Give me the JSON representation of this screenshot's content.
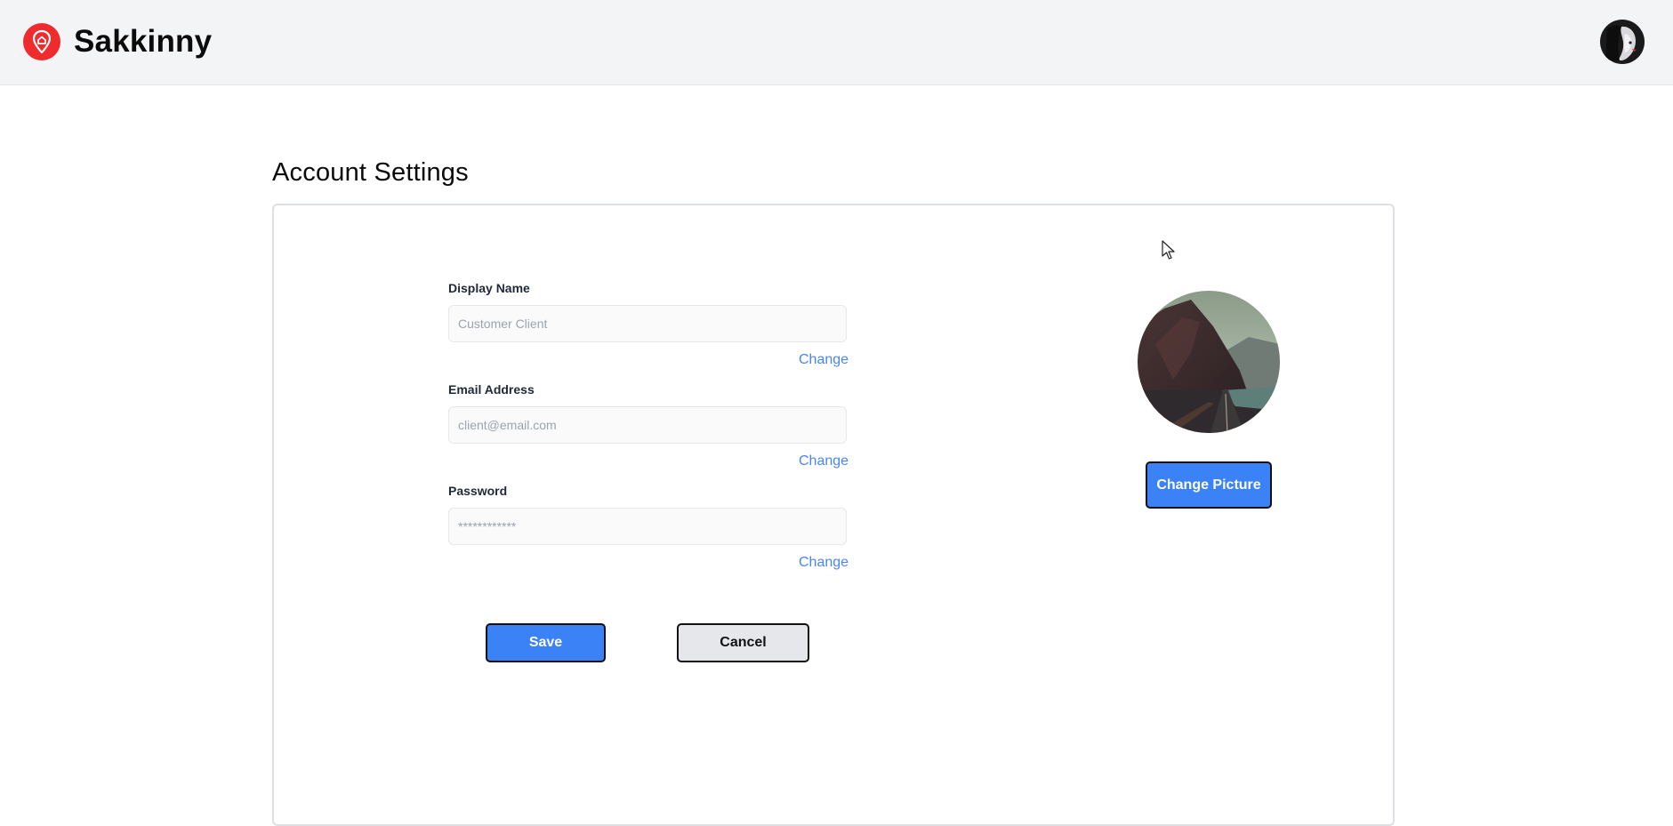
{
  "header": {
    "brand_name": "Sakkinny",
    "logo_icon": "location-pin-icon",
    "avatar_icon": "user-avatar",
    "brand_color": "#ef2b2d"
  },
  "page": {
    "title": "Account Settings"
  },
  "form": {
    "display_name": {
      "label": "Display Name",
      "placeholder": "Customer Client",
      "value": "",
      "change_label": "Change"
    },
    "email": {
      "label": "Email Address",
      "placeholder": "client@email.com",
      "value": "",
      "change_label": "Change"
    },
    "password": {
      "label": "Password",
      "placeholder": "************",
      "value": "",
      "change_label": "Change"
    }
  },
  "actions": {
    "save_label": "Save",
    "cancel_label": "Cancel"
  },
  "profile": {
    "picture_icon": "mountain-road-photo",
    "change_picture_label": "Change Picture"
  },
  "colors": {
    "accent": "#3b82f6",
    "link": "#4a86f0",
    "header_bg": "#f3f4f6"
  }
}
